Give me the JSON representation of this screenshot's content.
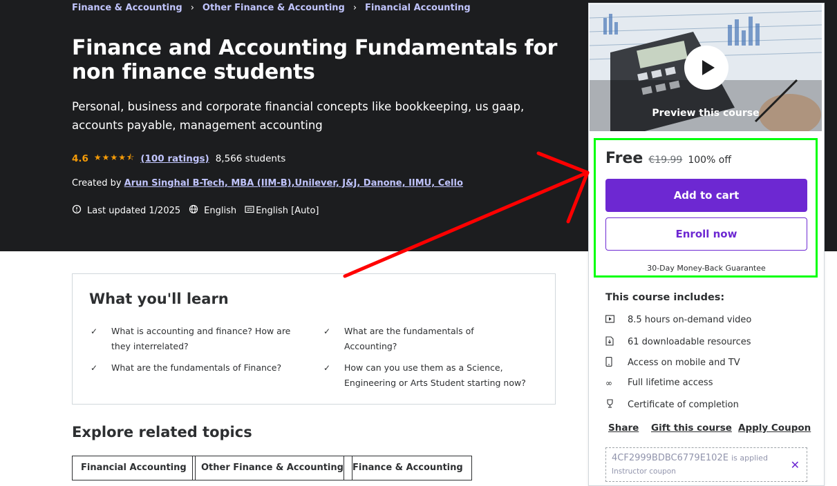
{
  "breadcrumb": [
    "Finance & Accounting",
    "Other Finance & Accounting",
    "Financial Accounting"
  ],
  "course": {
    "title": "Finance and Accounting Fundamentals for non finance students",
    "subtitle": "Personal, business and corporate financial concepts like bookkeeping, us gaap, accounts payable, management accounting",
    "rating": "4.6",
    "stars": "★★★★⯪",
    "ratings_count": "(100 ratings)",
    "students": "8,566 students",
    "created_prefix": "Created by",
    "instructor": "Arun Singhal B-Tech, MBA (IIM-B),Unilever, J&J, Danone, IIMU, Cello",
    "last_updated": "Last updated 1/2025",
    "language": "English",
    "captions": "English [Auto]"
  },
  "learn": {
    "heading": "What you'll learn",
    "items": [
      "What is accounting and finance? How are they interrelated?",
      "What are the fundamentals of Accounting?",
      "What are the fundamentals of Finance?",
      "How can you use them as a Science, Engineering or Arts Student starting now?"
    ]
  },
  "topics": {
    "heading": "Explore related topics",
    "items": [
      "Financial Accounting",
      "Other Finance & Accounting",
      "Finance & Accounting"
    ]
  },
  "sidebar": {
    "preview_label": "Preview this course",
    "price": "Free",
    "original_price": "€19.99",
    "discount": "100% off",
    "add_to_cart": "Add to cart",
    "enroll": "Enroll now",
    "guarantee": "30-Day Money-Back Guarantee",
    "includes_heading": "This course includes:",
    "includes": [
      {
        "icon": "video-icon",
        "label": "8.5 hours on-demand video"
      },
      {
        "icon": "file-download-icon",
        "label": "61 downloadable resources"
      },
      {
        "icon": "mobile-icon",
        "label": "Access on mobile and TV"
      },
      {
        "icon": "infinity-icon",
        "label": "Full lifetime access"
      },
      {
        "icon": "trophy-icon",
        "label": "Certificate of completion"
      }
    ],
    "share": "Share",
    "gift": "Gift this course",
    "apply_coupon": "Apply Coupon",
    "coupon_code": "4CF2999BDBC6779E102E",
    "coupon_applied": "is applied",
    "coupon_sub": "Instructor coupon"
  },
  "colors": {
    "accent": "#6d28d2",
    "hero_bg": "#1c1d1f",
    "link": "#c0c4fc",
    "star": "#f69c08",
    "annotation_box": "#00ff0a",
    "annotation_arrow": "#ff0000"
  }
}
